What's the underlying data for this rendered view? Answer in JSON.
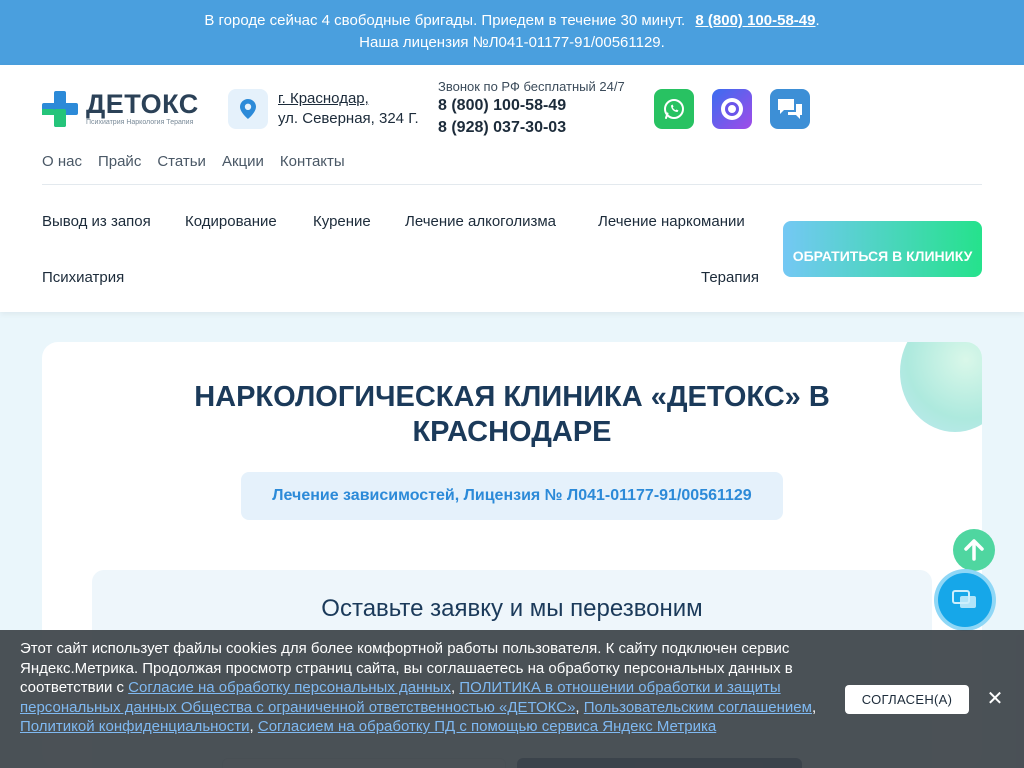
{
  "banner": {
    "line1": "В городе сейчас 4 свободные бригады. Приедем в течение 30 минут.",
    "phone": "8 (800) 100-58-49",
    "line2": "Наша лицензия №Л041-01177-91/00561129."
  },
  "logo": {
    "title": "ДЕТОКС",
    "subtitle": "Психиатрия Наркология Терапия"
  },
  "location": {
    "city": "г. Краснодар,",
    "address": "ул. Северная, 324 Г."
  },
  "phones": {
    "label": "Звонок по РФ бесплатный 24/7",
    "phone1": "8 (800) 100-58-49",
    "phone2": "8 (928) 037-30-03"
  },
  "topnav": [
    "О нас",
    "Прайс",
    "Статьи",
    "Акции",
    "Контакты"
  ],
  "mainnav": {
    "withdrawal": "Вывод из запоя",
    "coding": "Кодирование",
    "smoking": "Курение",
    "alcoholism": "Лечение алкоголизма",
    "drugs": "Лечение наркомании",
    "psychiatry": "Психиатрия",
    "therapy": "Терапия"
  },
  "cta_label": "ОБРАТИТЬСЯ В КЛИНИКУ",
  "hero": {
    "title": "Наркологическая клиника «Детокс» в Краснодаре",
    "license": "Лечение зависимостей, Лицензия № Л041-01177-91/00561129"
  },
  "form": {
    "title": "Оставьте заявку и мы перезвоним"
  },
  "cookie": {
    "text1": "Этот сайт использует файлы cookies для более комфортной работы пользователя. К сайту подключен сервис Яндекс.Метрика. Продолжая просмотр страниц сайта, вы соглашаетесь на обработку персональных данных в соответствии с ",
    "link1": "Согласие на обработку персональных данных",
    "sep1": ", ",
    "link2": "ПОЛИТИКА в отношении обработки и защиты персональных данных Общества с ограниченной ответственностью «ДЕТОКС»",
    "sep2": ", ",
    "link3": "Пользовательским соглашением",
    "sep3": ", ",
    "link4": "Политикой конфиденциальности",
    "sep4": ", ",
    "link5": "Согласием на обработку ПД с помощью сервиса Яндекс Метрика",
    "accept": "СОГЛАСЕН(А)",
    "close": "✕"
  },
  "colors": {
    "banner": "#4a9fde",
    "accent_blue": "#2c8ad8",
    "accent_green": "#25e28c",
    "whatsapp": "#28c262",
    "dark_navy": "#1b3a5a"
  },
  "icons": [
    "location-pin-icon",
    "whatsapp-icon",
    "max-messenger-icon",
    "chat-icon",
    "arrow-up-icon",
    "chat-bubbles-icon",
    "close-icon"
  ]
}
